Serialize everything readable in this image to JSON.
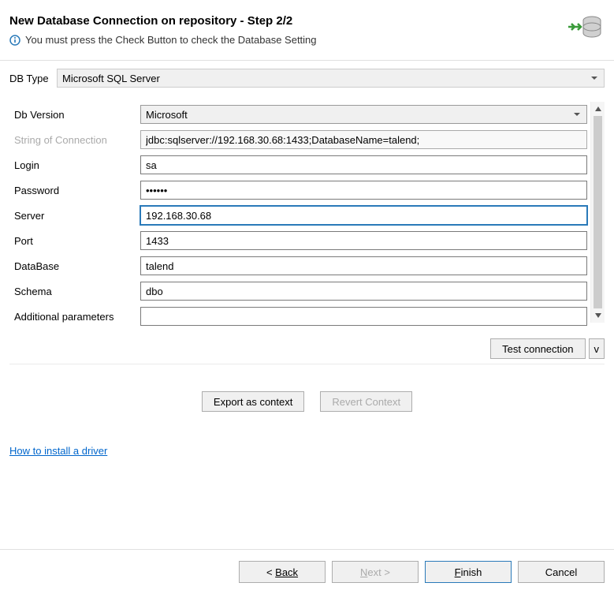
{
  "header": {
    "title": "New Database Connection on repository - Step 2/2",
    "info_text": "You must press the Check Button to check the Database Setting"
  },
  "db_type": {
    "label": "DB Type",
    "value": "Microsoft SQL Server"
  },
  "form": {
    "db_version": {
      "label": "Db Version",
      "value": "Microsoft"
    },
    "connection_string": {
      "label": "String of Connection",
      "value": "jdbc:sqlserver://192.168.30.68:1433;DatabaseName=talend;"
    },
    "login": {
      "label": "Login",
      "value": "sa"
    },
    "password": {
      "label": "Password",
      "value": "••••••"
    },
    "server": {
      "label": "Server",
      "value": "192.168.30.68"
    },
    "port": {
      "label": "Port",
      "value": "1433"
    },
    "database": {
      "label": "DataBase",
      "value": "talend"
    },
    "schema": {
      "label": "Schema",
      "value": "dbo"
    },
    "additional": {
      "label": "Additional parameters",
      "value": ""
    }
  },
  "buttons": {
    "test_connection": "Test connection",
    "test_dropdown": "v",
    "export_context": "Export as context",
    "revert_context": "Revert Context",
    "back": "Back",
    "next": "Next >",
    "finish": "Finish",
    "cancel": "Cancel"
  },
  "link": {
    "install_driver": "How to install a driver"
  }
}
